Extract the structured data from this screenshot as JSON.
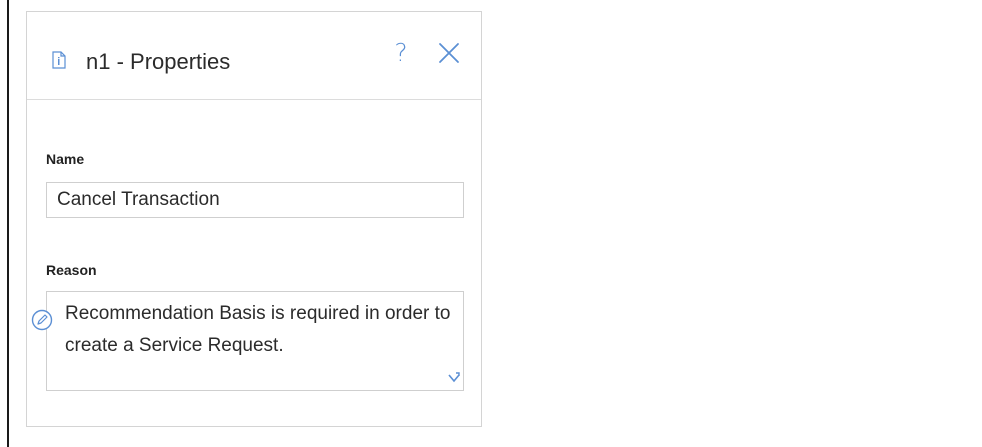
{
  "panel": {
    "title": "n1 - Properties",
    "help_glyph": "?",
    "icons": {
      "document": "document-icon",
      "help": "help-icon",
      "close": "close-icon",
      "edit": "edit-icon",
      "resize": "resize-handle-icon"
    }
  },
  "fields": {
    "name_label": "Name",
    "name_value": "Cancel Transaction",
    "reason_label": "Reason",
    "reason_value": "Recommendation Basis is required in order to create a Service Request."
  },
  "colors": {
    "accent": "#5b8fd4",
    "border": "#cfcfcf",
    "text": "#2b2b2b"
  }
}
